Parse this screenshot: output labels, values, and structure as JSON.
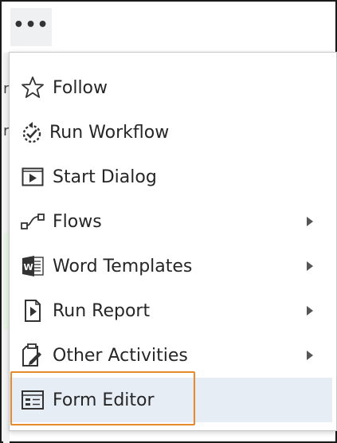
{
  "more_button": {
    "label": "•••",
    "icon": "more-horizontal-icon"
  },
  "menu": {
    "items": [
      {
        "label": "Follow",
        "icon": "star-icon",
        "has_submenu": false
      },
      {
        "label": "Run Workflow",
        "icon": "run-workflow-icon",
        "has_submenu": false
      },
      {
        "label": "Start Dialog",
        "icon": "start-dialog-icon",
        "has_submenu": false
      },
      {
        "label": "Flows",
        "icon": "flows-icon",
        "has_submenu": true
      },
      {
        "label": "Word Templates",
        "icon": "word-icon",
        "has_submenu": true
      },
      {
        "label": "Run Report",
        "icon": "report-icon",
        "has_submenu": true
      },
      {
        "label": "Other Activities",
        "icon": "clipboard-icon",
        "has_submenu": true
      },
      {
        "label": "Form Editor",
        "icon": "form-editor-icon",
        "has_submenu": false,
        "selected": true
      }
    ]
  },
  "colors": {
    "highlight_border": "#e8892b",
    "selected_bg": "#e6edf5",
    "text": "#262626"
  }
}
